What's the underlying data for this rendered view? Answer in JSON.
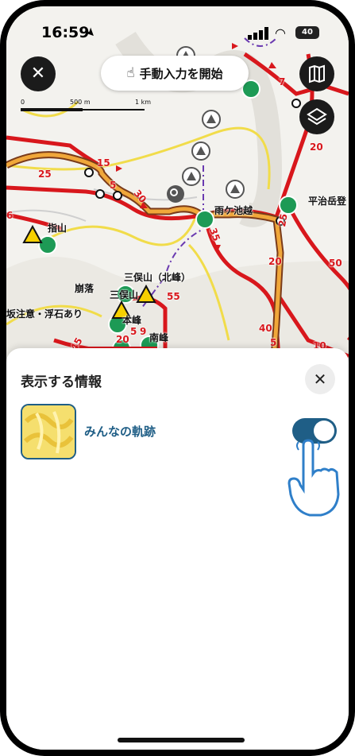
{
  "status": {
    "time": "16:59",
    "battery": "40"
  },
  "top": {
    "manual_label": "手動入力を開始"
  },
  "scale": {
    "zero": "0",
    "mid": "500 m",
    "end": "1 km"
  },
  "map_labels": {
    "shiyama": "指山",
    "amagaike": "雨ケ池越",
    "hiraji": "平治岳登",
    "kuzure": "崩落",
    "mimata_n": "三俣山（北峰）",
    "mimata": "三俣山",
    "sakachui": "坂注意・浮石あり",
    "honmine": "本峰",
    "minamimine": "南峰",
    "num_25a": "25",
    "num_15": "15",
    "num_30": "30",
    "num_5a": "5",
    "num_7": "7",
    "num_20a": "20",
    "num_35": "35",
    "num_25b": "25",
    "num_20b": "20",
    "num_50": "50",
    "num_55": "55",
    "num_40": "40",
    "num_10": "10",
    "num_5b": "5",
    "num_20c": "20",
    "num_5c": "5",
    "num_9": "9",
    "num_6": "6",
    "num_45": "45"
  },
  "sheet": {
    "title": "表示する情報",
    "item_label": "みんなの軌跡",
    "toggle_on": true
  },
  "colors": {
    "accent": "#1f5e86",
    "route_red": "#d8171c",
    "route_orange": "#e2a03d",
    "shelter_green": "#1d9a55"
  }
}
